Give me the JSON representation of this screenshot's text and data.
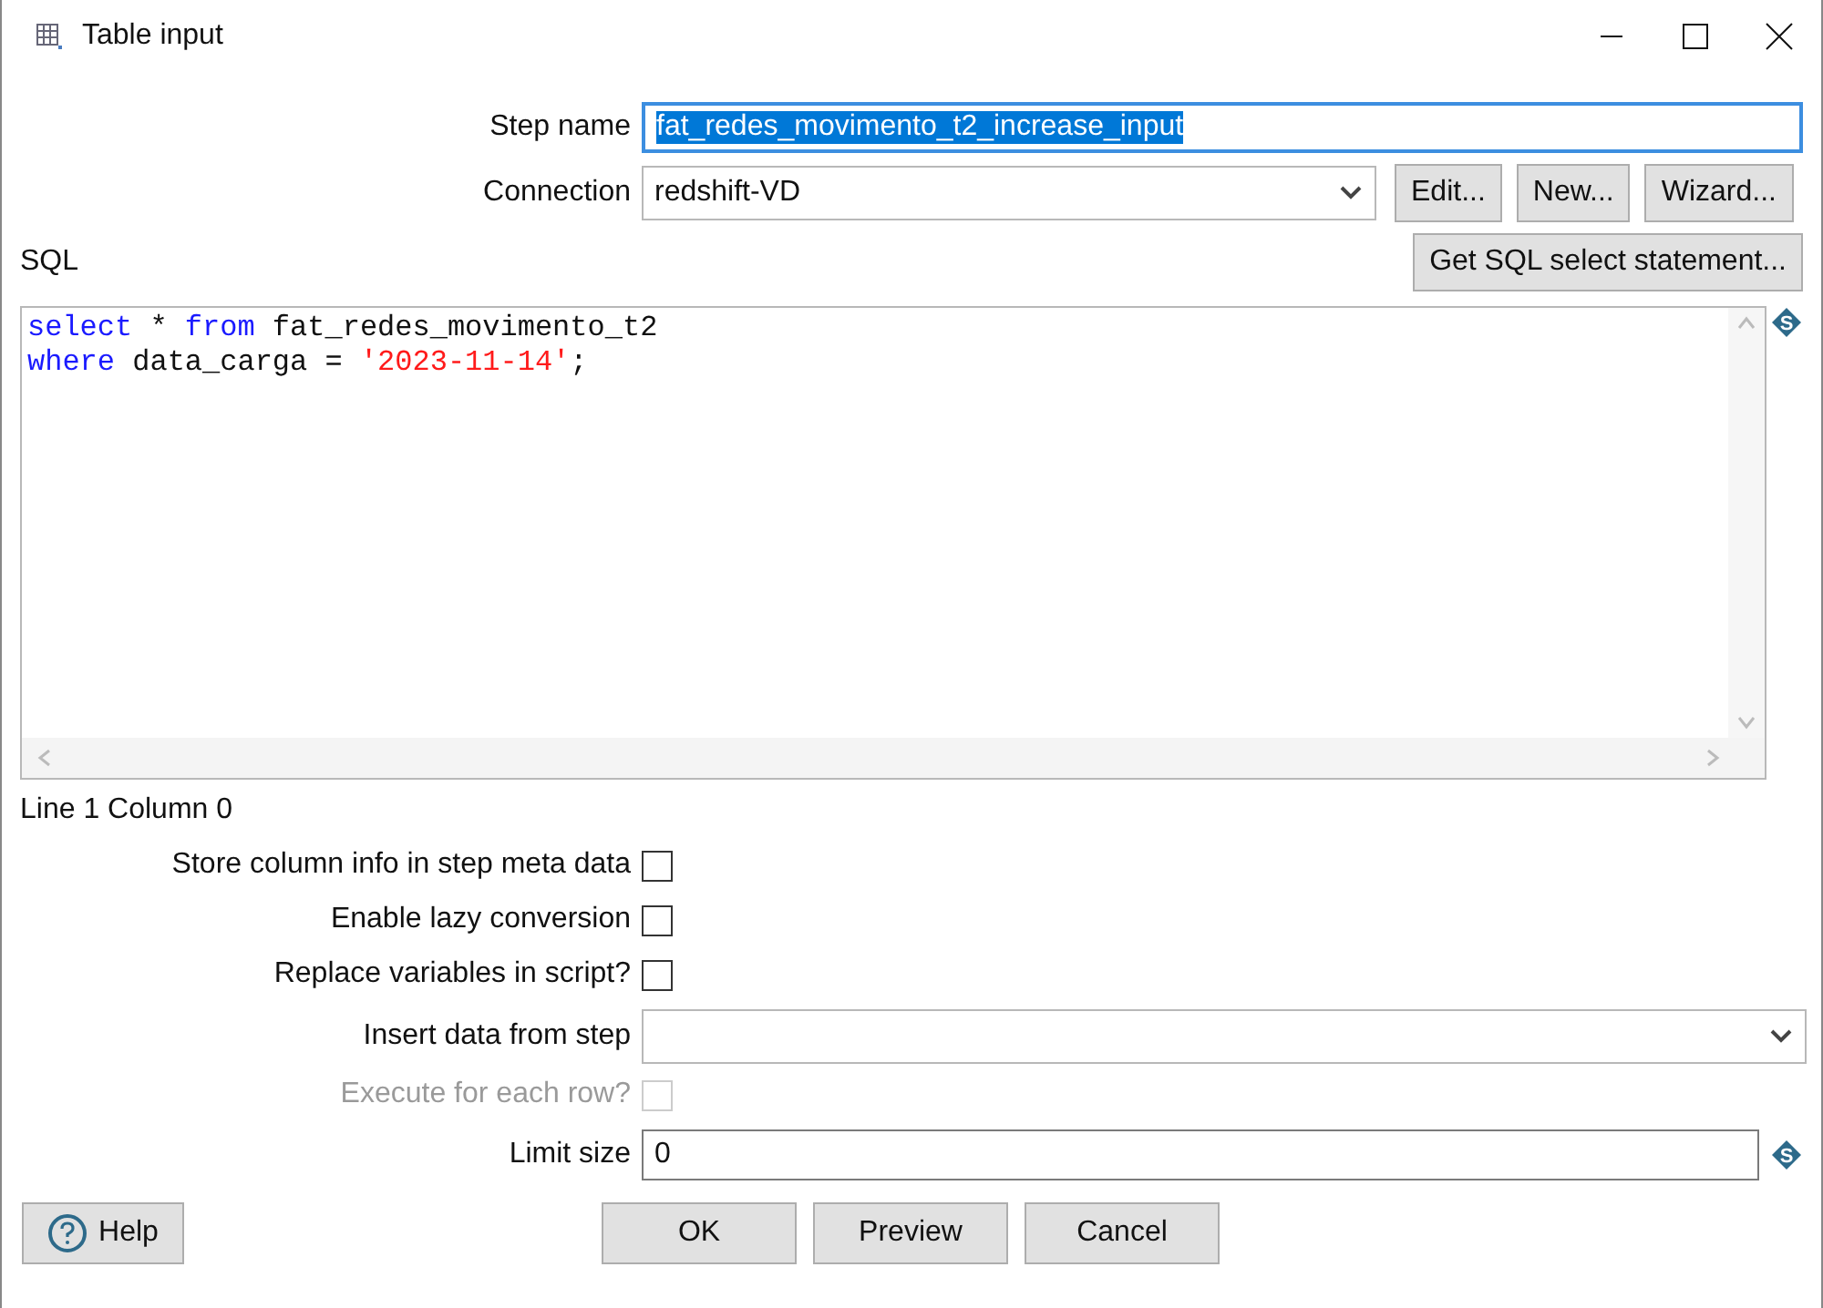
{
  "window": {
    "title": "Table input"
  },
  "step_name": {
    "label": "Step name",
    "value": "fat_redes_movimento_t2_increase_input",
    "text_selected": true
  },
  "connection": {
    "label": "Connection",
    "value": "redshift-VD"
  },
  "connection_buttons": [
    "Edit...",
    "New...",
    "Wizard..."
  ],
  "sql": {
    "label": "SQL",
    "variable_marker": "S",
    "get_button": "Get SQL select statement...",
    "lines": [
      [
        {
          "text": "select",
          "kind": "keyword"
        },
        {
          "text": " * ",
          "kind": "plain"
        },
        {
          "text": "from",
          "kind": "keyword"
        },
        {
          "text": " fat_redes_movimento_t2",
          "kind": "plain"
        }
      ],
      [
        {
          "text": "where",
          "kind": "keyword"
        },
        {
          "text": " data_carga = ",
          "kind": "plain"
        },
        {
          "text": "'2023-11-14'",
          "kind": "string"
        },
        {
          "text": ";",
          "kind": "plain"
        }
      ]
    ]
  },
  "status": "Line 1 Column 0",
  "options": [
    {
      "label": "Store column info in step meta data",
      "checked": false,
      "disabled": false
    },
    {
      "label": "Enable lazy conversion",
      "checked": false,
      "disabled": false
    },
    {
      "label": "Replace variables in script?",
      "checked": false,
      "disabled": false
    }
  ],
  "insert_from_step": {
    "label": "Insert data from step"
  },
  "execute_each_row": {
    "label": "Execute for each row?",
    "checked": false,
    "disabled": true
  },
  "limit_size": {
    "label": "Limit size",
    "value": "0",
    "variable_marker": "S"
  },
  "help_button": "Help",
  "buttons": [
    "OK",
    "Preview",
    "Cancel"
  ]
}
